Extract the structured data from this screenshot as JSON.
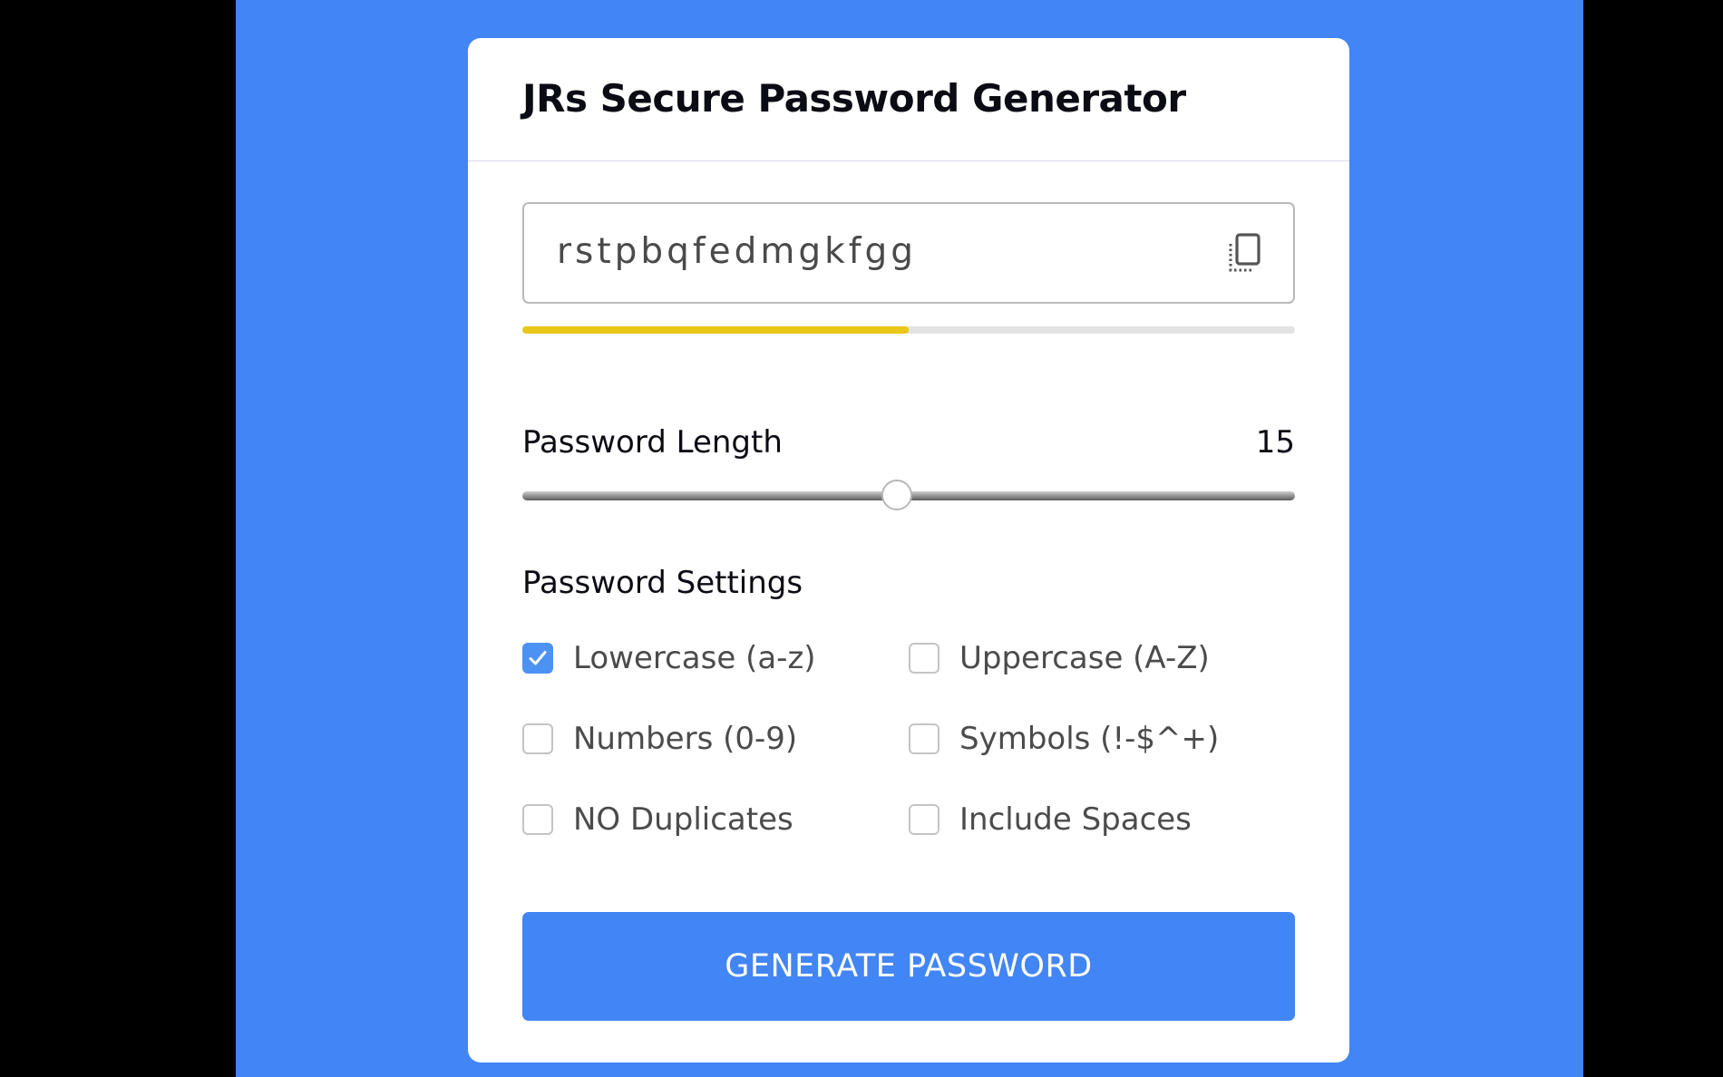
{
  "app": {
    "title": "JRs Secure Password Generator"
  },
  "password": {
    "value": "rstpbqfedmgkfgg",
    "copy_icon": "copy-icon"
  },
  "strength": {
    "fraction": 0.5,
    "color": "#e9c717"
  },
  "length": {
    "label": "Password Length",
    "value": "15",
    "slider_fraction": 0.485
  },
  "settings": {
    "title": "Password Settings",
    "options": [
      {
        "label": "Lowercase (a-z)",
        "checked": true
      },
      {
        "label": "Uppercase (A-Z)",
        "checked": false
      },
      {
        "label": "Numbers (0-9)",
        "checked": false
      },
      {
        "label": "Symbols (!-$^+)",
        "checked": false
      },
      {
        "label": "NO Duplicates",
        "checked": false
      },
      {
        "label": "Include Spaces",
        "checked": false
      }
    ]
  },
  "generate_button": {
    "label": "GENERATE PASSWORD"
  },
  "colors": {
    "background": "#4285f4",
    "accent": "#4285f4",
    "checkbox_checked": "#4d92f3"
  }
}
